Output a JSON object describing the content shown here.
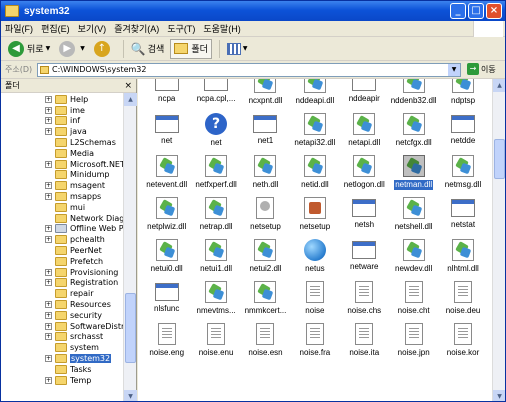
{
  "window": {
    "title": "system32"
  },
  "menu": [
    "파일(F)",
    "편집(E)",
    "보기(V)",
    "즐겨찾기(A)",
    "도구(T)",
    "도움말(H)"
  ],
  "toolbar": {
    "back": "뒤로",
    "search": "검색",
    "folders": "폴더"
  },
  "address": {
    "label": "주소(D)",
    "value": "C:\\WINDOWS\\system32",
    "go": "이동"
  },
  "left_pane": {
    "title": "폴더",
    "items": [
      {
        "label": "Help",
        "expandable": true
      },
      {
        "label": "ime",
        "expandable": true
      },
      {
        "label": "inf",
        "expandable": true
      },
      {
        "label": "java",
        "expandable": true
      },
      {
        "label": "L2Schemas",
        "expandable": false
      },
      {
        "label": "Media",
        "expandable": false
      },
      {
        "label": "Microsoft.NET",
        "expandable": true
      },
      {
        "label": "Minidump",
        "expandable": false
      },
      {
        "label": "msagent",
        "expandable": true
      },
      {
        "label": "msapps",
        "expandable": true
      },
      {
        "label": "mui",
        "expandable": false
      },
      {
        "label": "Network Diagn",
        "expandable": false
      },
      {
        "label": "Offline Web Pa",
        "expandable": true,
        "special": true
      },
      {
        "label": "pchealth",
        "expandable": true
      },
      {
        "label": "PeerNet",
        "expandable": false
      },
      {
        "label": "Prefetch",
        "expandable": false
      },
      {
        "label": "Provisioning",
        "expandable": true
      },
      {
        "label": "Registration",
        "expandable": true
      },
      {
        "label": "repair",
        "expandable": false
      },
      {
        "label": "Resources",
        "expandable": true
      },
      {
        "label": "security",
        "expandable": true
      },
      {
        "label": "SoftwareDistrib",
        "expandable": true
      },
      {
        "label": "srchasst",
        "expandable": true
      },
      {
        "label": "system",
        "expandable": false
      },
      {
        "label": "system32",
        "expandable": true
      },
      {
        "label": "Tasks",
        "expandable": false
      },
      {
        "label": "Temp",
        "expandable": true
      }
    ]
  },
  "files": [
    {
      "name": "ncpa",
      "icon": "win"
    },
    {
      "name": "ncpa.cpl,...",
      "icon": "win"
    },
    {
      "name": "ncxpnt.dll",
      "icon": "dll"
    },
    {
      "name": "nddeapi.dll",
      "icon": "dll"
    },
    {
      "name": "nddeapir",
      "icon": "win"
    },
    {
      "name": "nddenb32.dll",
      "icon": "dll"
    },
    {
      "name": "ndptsp",
      "icon": "dll"
    },
    {
      "name": "net",
      "icon": "win"
    },
    {
      "name": "net",
      "icon": "help"
    },
    {
      "name": "net1",
      "icon": "win"
    },
    {
      "name": "netapi32.dll",
      "icon": "dll"
    },
    {
      "name": "netapi.dll",
      "icon": "dll"
    },
    {
      "name": "netcfgx.dll",
      "icon": "dll"
    },
    {
      "name": "netdde",
      "icon": "win"
    },
    {
      "name": "netevent.dll",
      "icon": "dll"
    },
    {
      "name": "netfxperf.dll",
      "icon": "dll"
    },
    {
      "name": "neth.dll",
      "icon": "dll"
    },
    {
      "name": "netid.dll",
      "icon": "dll"
    },
    {
      "name": "netlogon.dll",
      "icon": "dll"
    },
    {
      "name": "netman.dll",
      "icon": "dll",
      "selected": true
    },
    {
      "name": "netmsg.dll",
      "icon": "dll"
    },
    {
      "name": "netplwiz.dll",
      "icon": "dll"
    },
    {
      "name": "netrap.dll",
      "icon": "dll"
    },
    {
      "name": "netsetup",
      "icon": "cfg"
    },
    {
      "name": "netsetup",
      "icon": "inst"
    },
    {
      "name": "netsh",
      "icon": "win"
    },
    {
      "name": "netshell.dll",
      "icon": "dll"
    },
    {
      "name": "netstat",
      "icon": "win"
    },
    {
      "name": "netui0.dll",
      "icon": "dll"
    },
    {
      "name": "netui1.dll",
      "icon": "dll"
    },
    {
      "name": "netui2.dll",
      "icon": "dll"
    },
    {
      "name": "netus",
      "icon": "globe"
    },
    {
      "name": "netware",
      "icon": "win"
    },
    {
      "name": "newdev.dll",
      "icon": "dll"
    },
    {
      "name": "nlhtml.dll",
      "icon": "dll"
    },
    {
      "name": "nlsfunc",
      "icon": "win"
    },
    {
      "name": "nmevtms...",
      "icon": "dll"
    },
    {
      "name": "nmmkcert...",
      "icon": "dll"
    },
    {
      "name": "noise",
      "icon": "file"
    },
    {
      "name": "noise.chs",
      "icon": "file"
    },
    {
      "name": "noise.cht",
      "icon": "file"
    },
    {
      "name": "noise.deu",
      "icon": "file"
    },
    {
      "name": "noise.eng",
      "icon": "file"
    },
    {
      "name": "noise.enu",
      "icon": "file"
    },
    {
      "name": "noise.esn",
      "icon": "file"
    },
    {
      "name": "noise.fra",
      "icon": "file"
    },
    {
      "name": "noise.ita",
      "icon": "file"
    },
    {
      "name": "noise.jpn",
      "icon": "file"
    },
    {
      "name": "noise.kor",
      "icon": "file"
    }
  ]
}
